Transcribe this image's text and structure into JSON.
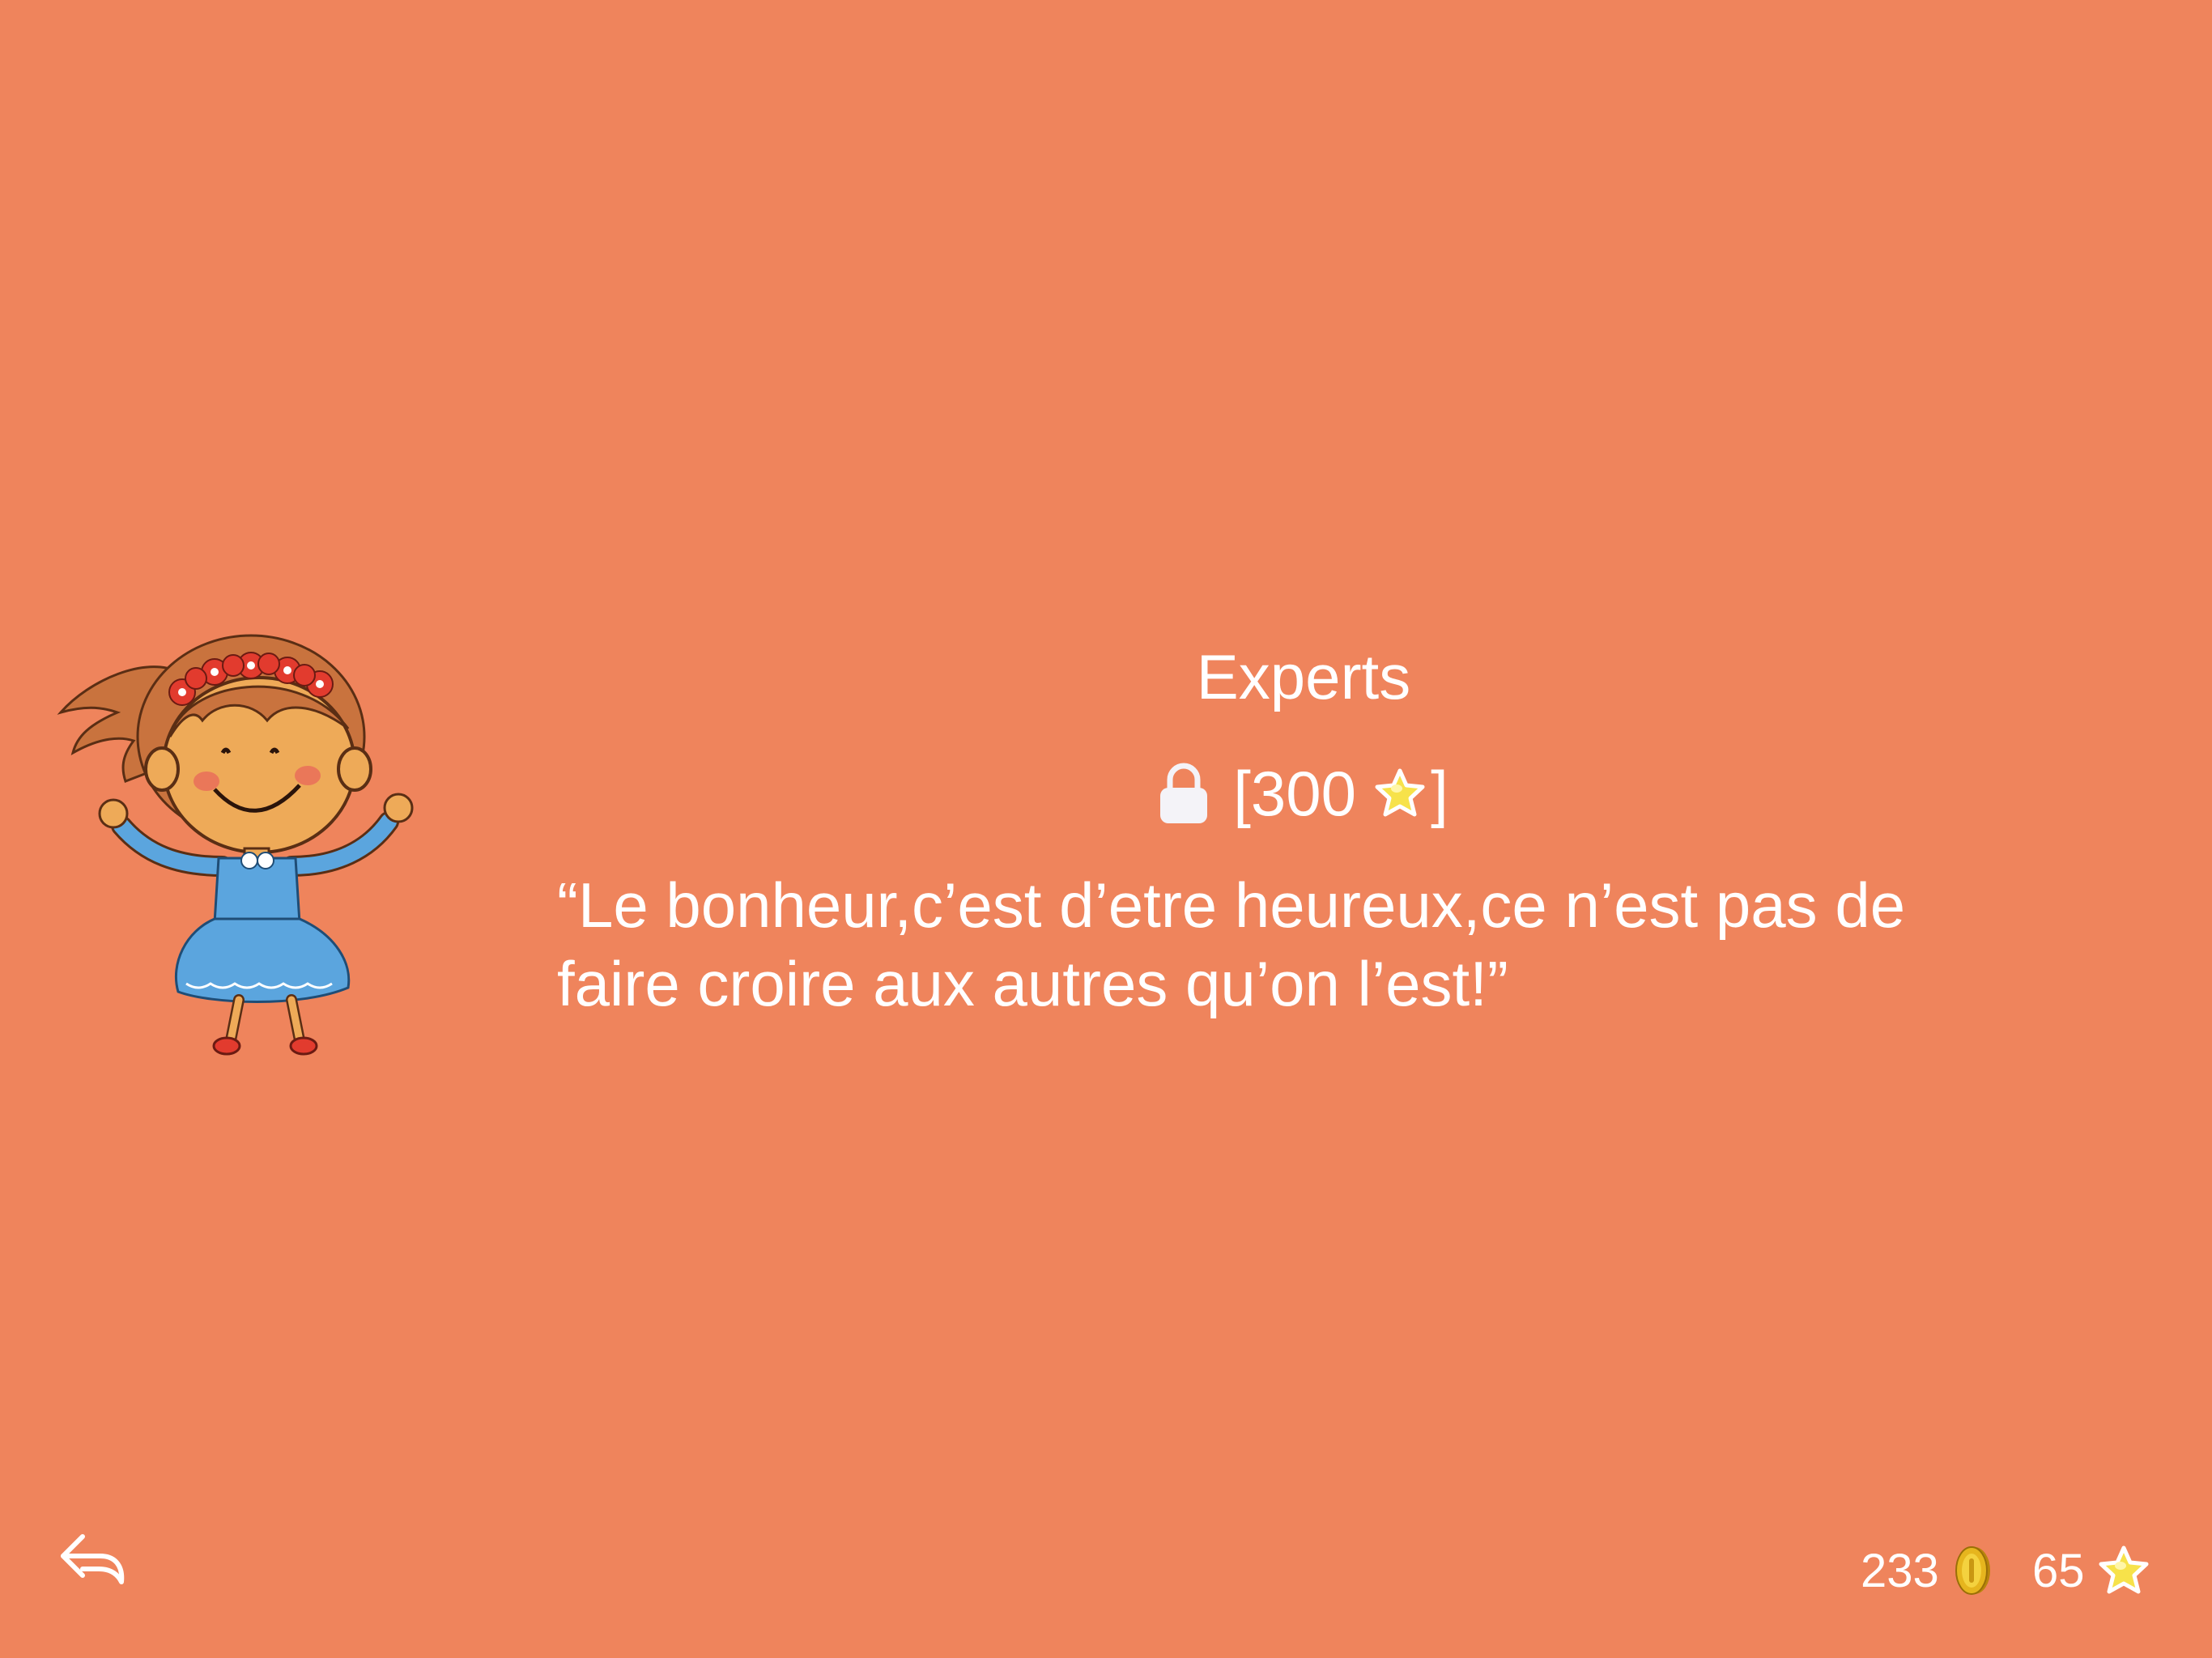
{
  "level": {
    "title": "Experts",
    "requirement": {
      "open_bracket": "[",
      "value": "300",
      "close_bracket": "]",
      "icon": "star-icon",
      "locked_icon": "lock-icon"
    },
    "quote_lines": [
      "“Le bonheur,c’est d’etre heureux,ce n’est pas de",
      "faire croire aux autres qu’on l’est!”"
    ]
  },
  "character": {
    "icon": "girl-character-illustration"
  },
  "footer": {
    "back_icon": "back-arrow-icon",
    "coins": "233",
    "coins_icon": "coin-icon",
    "stars": "65",
    "stars_icon": "star-icon"
  },
  "colors": {
    "background": "#EF845C",
    "text": "#FFFFFF",
    "star": "#F7E24A",
    "coin": "#E6B51E"
  }
}
